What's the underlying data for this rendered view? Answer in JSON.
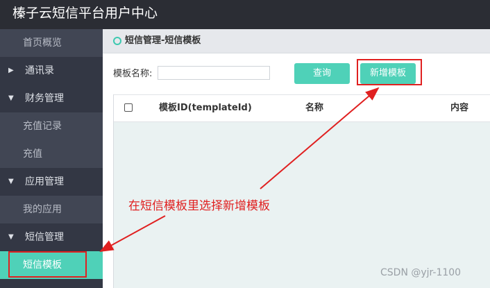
{
  "app": {
    "title": "榛子云短信平台用户中心"
  },
  "sidebar": {
    "items": [
      {
        "label": "首页概览",
        "kind": "sub"
      },
      {
        "label": "通讯录",
        "kind": "group",
        "caret": "▶"
      },
      {
        "label": "财务管理",
        "kind": "group",
        "caret": "▼"
      },
      {
        "label": "充值记录",
        "kind": "sub"
      },
      {
        "label": "充值",
        "kind": "sub"
      },
      {
        "label": "应用管理",
        "kind": "group",
        "caret": "▼"
      },
      {
        "label": "我的应用",
        "kind": "sub"
      },
      {
        "label": "短信管理",
        "kind": "group",
        "caret": "▼"
      },
      {
        "label": "短信模板",
        "kind": "active"
      }
    ]
  },
  "page": {
    "title": "短信管理-短信模板"
  },
  "search": {
    "label": "模板名称:",
    "value": "",
    "placeholder": ""
  },
  "buttons": {
    "query": "查询",
    "add": "新增模板"
  },
  "table": {
    "columns": [
      "模板ID(templateId)",
      "名称",
      "内容"
    ]
  },
  "annotation": {
    "text": "在短信模板里选择新增模板"
  },
  "watermark": "CSDN @yjr-1100",
  "colors": {
    "accent": "#4fd1b8",
    "sidebar": "#333744",
    "annotation": "#e02020"
  }
}
